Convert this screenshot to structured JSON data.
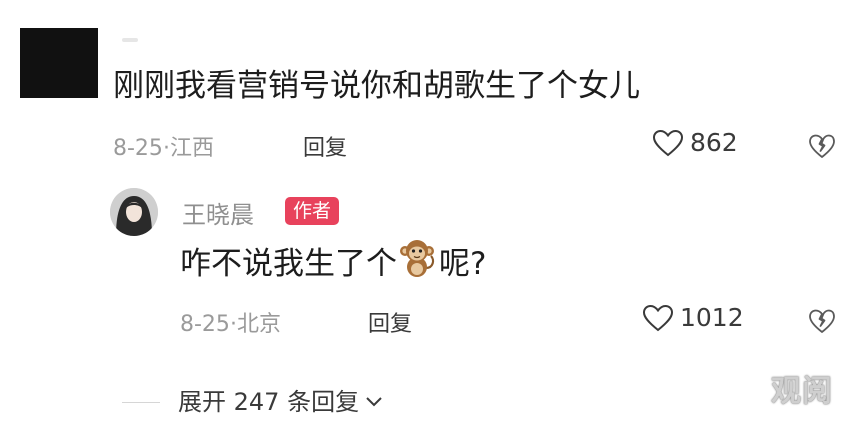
{
  "comment": {
    "username": "",
    "text": "刚刚我看营销号说你和胡歌生了个女儿",
    "date": "8-25",
    "location": "江西",
    "reply_label": "回复",
    "likes": "862"
  },
  "reply": {
    "username": "王晓晨",
    "badge": "作者",
    "text_before": "咋不说我生了个",
    "emoji": "monkey-emoji",
    "text_after": "呢?",
    "date": "8-25",
    "location": "北京",
    "reply_label": "回复",
    "likes": "1012"
  },
  "expand": {
    "label": "展开 247 条回复"
  },
  "watermark": "观阅",
  "colors": {
    "badge": "#e8425c",
    "meta": "#9a9a9a",
    "text": "#1d1d1d"
  }
}
